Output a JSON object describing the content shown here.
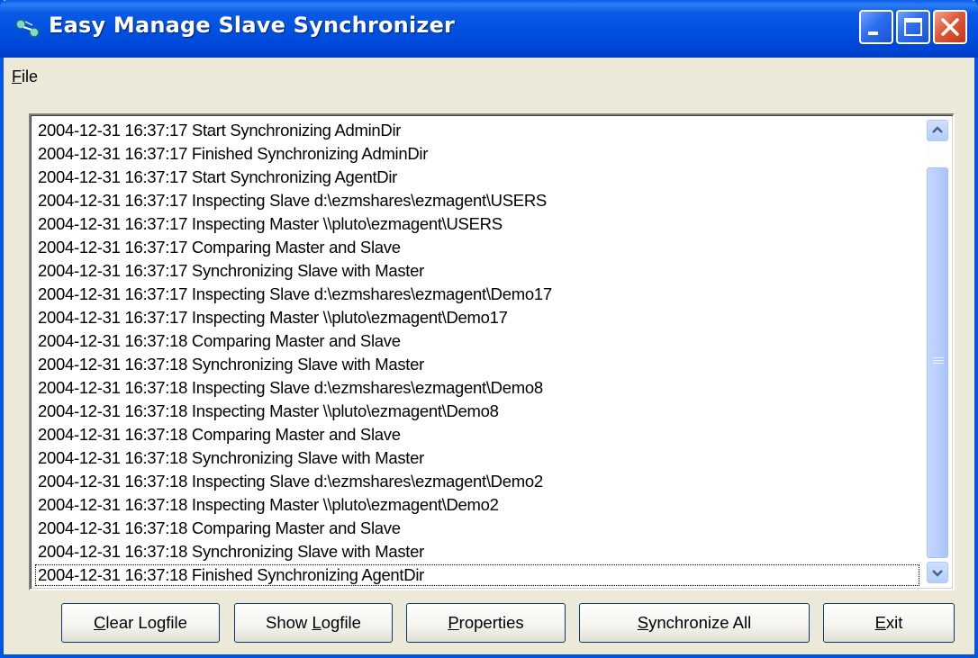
{
  "window": {
    "title": "Easy Manage Slave Synchronizer"
  },
  "menu": {
    "file_accel": "F",
    "file_rest": "ile"
  },
  "log": {
    "lines": [
      "2004-12-31 16:37:17 Start Synchronizing AdminDir",
      "2004-12-31 16:37:17 Finished Synchronizing AdminDir",
      "2004-12-31 16:37:17 Start Synchronizing AgentDir",
      "2004-12-31 16:37:17 Inspecting Slave d:\\ezmshares\\ezmagent\\USERS",
      "2004-12-31 16:37:17 Inspecting Master \\\\pluto\\ezmagent\\USERS",
      "2004-12-31 16:37:17 Comparing Master and Slave",
      "2004-12-31 16:37:17 Synchronizing Slave with Master",
      "2004-12-31 16:37:17 Inspecting Slave d:\\ezmshares\\ezmagent\\Demo17",
      "2004-12-31 16:37:17 Inspecting Master \\\\pluto\\ezmagent\\Demo17",
      "2004-12-31 16:37:18 Comparing Master and Slave",
      "2004-12-31 16:37:18 Synchronizing Slave with Master",
      "2004-12-31 16:37:18 Inspecting Slave d:\\ezmshares\\ezmagent\\Demo8",
      "2004-12-31 16:37:18 Inspecting Master \\\\pluto\\ezmagent\\Demo8",
      "2004-12-31 16:37:18 Comparing Master and Slave",
      "2004-12-31 16:37:18 Synchronizing Slave with Master",
      "2004-12-31 16:37:18 Inspecting Slave d:\\ezmshares\\ezmagent\\Demo2",
      "2004-12-31 16:37:18 Inspecting Master \\\\pluto\\ezmagent\\Demo2",
      "2004-12-31 16:37:18 Comparing Master and Slave",
      "2004-12-31 16:37:18 Synchronizing Slave with Master",
      "2004-12-31 16:37:18 Finished Synchronizing AgentDir"
    ]
  },
  "buttons": {
    "clear": {
      "accel": "C",
      "rest": "lear Logfile"
    },
    "show": {
      "before": "Show ",
      "accel": "L",
      "rest": "ogfile"
    },
    "properties": {
      "accel": "P",
      "rest": "roperties"
    },
    "sync": {
      "accel": "S",
      "rest": "ynchronize All"
    },
    "exit": {
      "accel": "E",
      "rest": "xit"
    }
  },
  "icons": {
    "app": "network-sync-icon",
    "minimize": "minimize-icon",
    "maximize": "maximize-icon",
    "close": "close-icon",
    "scroll_up": "scroll-up-arrow-icon",
    "scroll_down": "scroll-down-arrow-icon"
  },
  "colors": {
    "titlebar": "#0050e0",
    "close_button": "#e0583a",
    "window_face": "#ece9d8",
    "button_border": "#003c74",
    "scroll_thumb": "#b8cefc"
  }
}
